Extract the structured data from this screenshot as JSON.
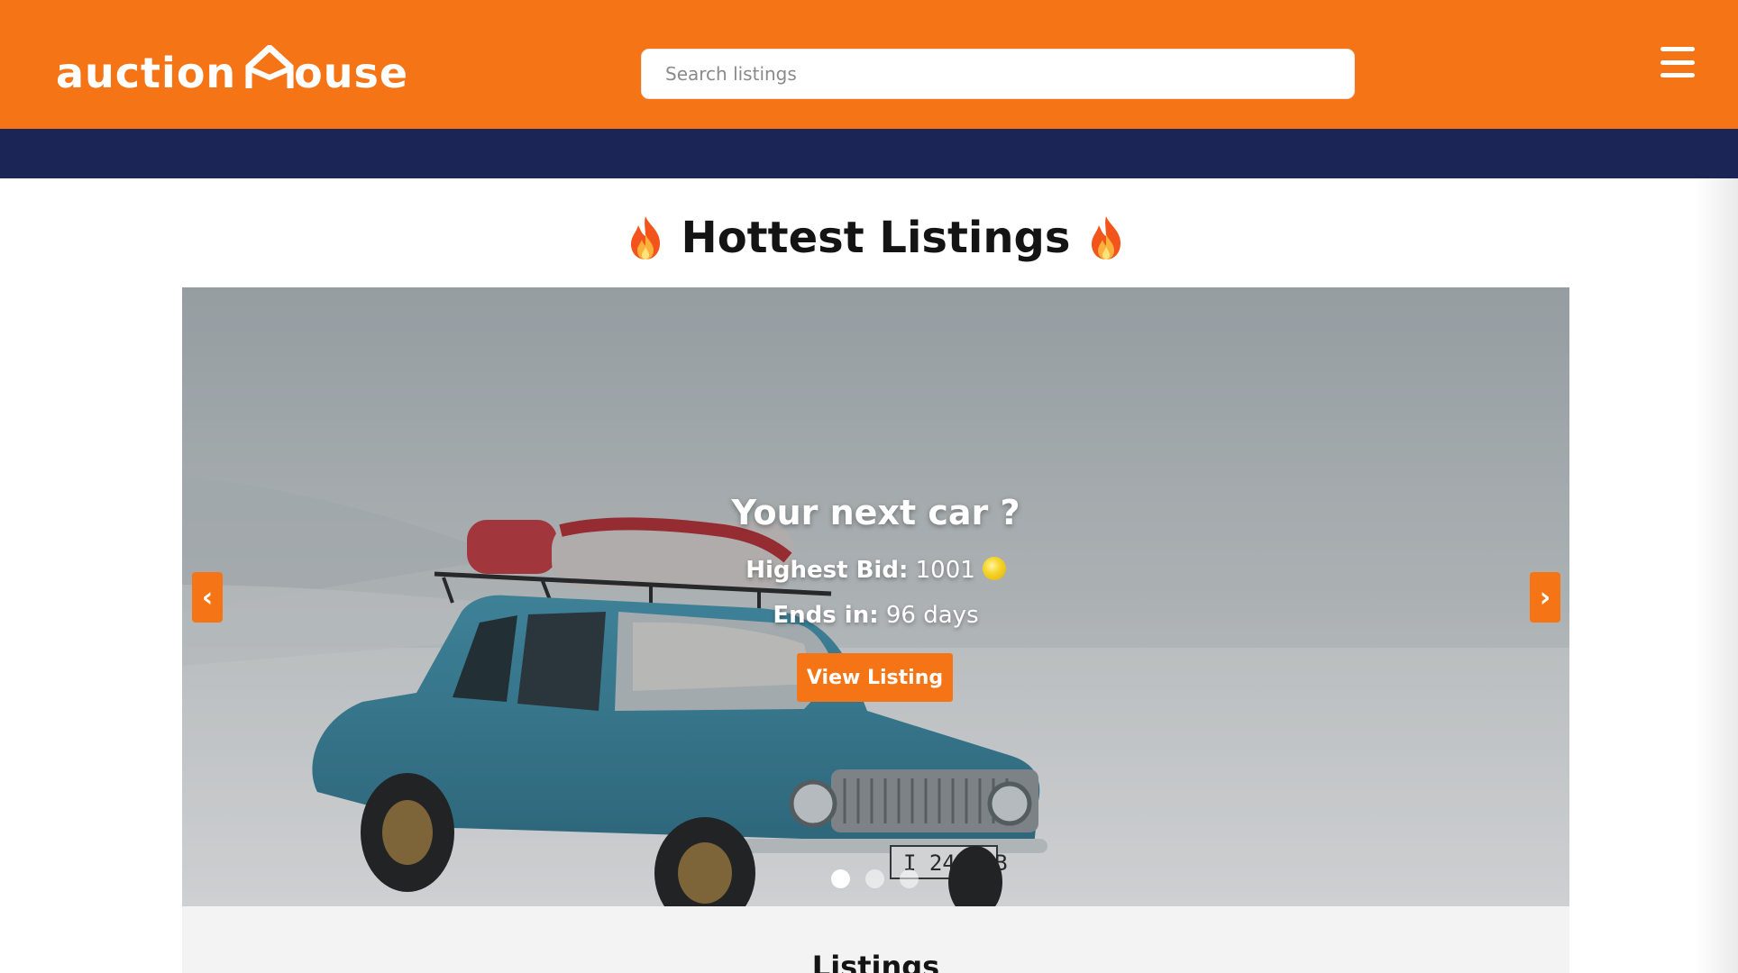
{
  "header": {
    "logo_text_left": "auction",
    "logo_text_right": "ouse",
    "search_placeholder": "Search listings",
    "brand_color": "#f57415",
    "nav_color": "#1b2657"
  },
  "hero": {
    "heading": "Hottest Listings",
    "heading_icon": "fire-icon"
  },
  "carousel": {
    "slide_title": "Your next car ?",
    "bid_label": "Highest Bid:",
    "bid_value": "1001",
    "ends_label": "Ends in:",
    "ends_value": "96 days",
    "button_label": "View Listing",
    "prev_symbol": "‹",
    "next_symbol": "›",
    "slide_count": 3,
    "active_slide": 1
  },
  "listings": {
    "title": "Listings"
  }
}
